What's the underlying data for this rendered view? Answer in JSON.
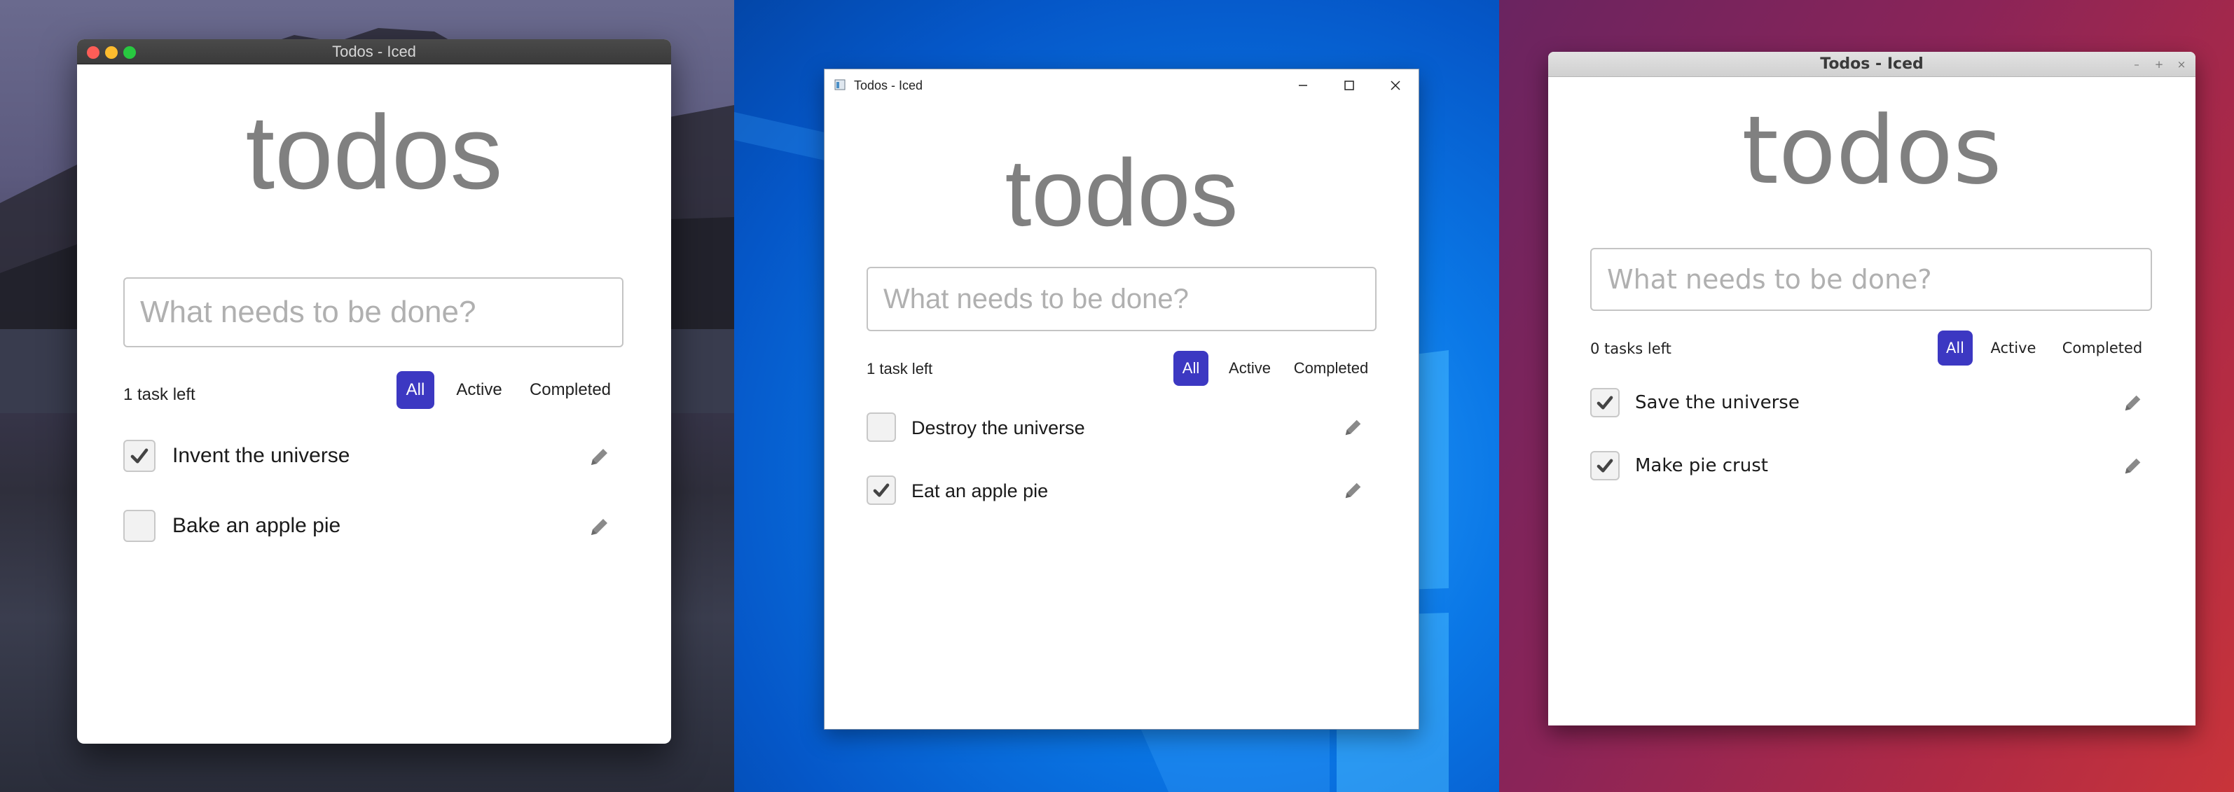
{
  "colors": {
    "accent": "#3c38c2",
    "heading": "#808080",
    "placeholder": "#b0b0b0",
    "mac_close": "#fc5d57",
    "mac_minimize": "#fdbc2e",
    "mac_maximize": "#28c840"
  },
  "windows": {
    "mac": {
      "title": "Todos - Iced",
      "heading": "todos",
      "input_placeholder": "What needs to be done?",
      "tasks_left": "1 task left",
      "filters": [
        "All",
        "Active",
        "Completed"
      ],
      "selected_filter": "All",
      "tasks": [
        {
          "label": "Invent the universe",
          "checked": true,
          "icon": "pencil-icon"
        },
        {
          "label": "Bake an apple pie",
          "checked": false,
          "icon": "pencil-icon"
        }
      ]
    },
    "win": {
      "title": "Todos - Iced",
      "heading": "todos",
      "input_placeholder": "What needs to be done?",
      "tasks_left": "1 task left",
      "filters": [
        "All",
        "Active",
        "Completed"
      ],
      "selected_filter": "All",
      "tasks": [
        {
          "label": "Destroy the universe",
          "checked": false,
          "icon": "pencil-icon"
        },
        {
          "label": "Eat an apple pie",
          "checked": true,
          "icon": "pencil-icon"
        }
      ]
    },
    "ubuntu": {
      "title": "Todos - Iced",
      "heading": "todos",
      "input_placeholder": "What needs to be done?",
      "tasks_left": "0 tasks left",
      "filters": [
        "All",
        "Active",
        "Completed"
      ],
      "selected_filter": "All",
      "controls": [
        "–",
        "+",
        "×"
      ],
      "tasks": [
        {
          "label": "Save the universe",
          "checked": true,
          "icon": "pencil-icon"
        },
        {
          "label": "Make pie crust",
          "checked": true,
          "icon": "pencil-icon"
        }
      ]
    }
  }
}
